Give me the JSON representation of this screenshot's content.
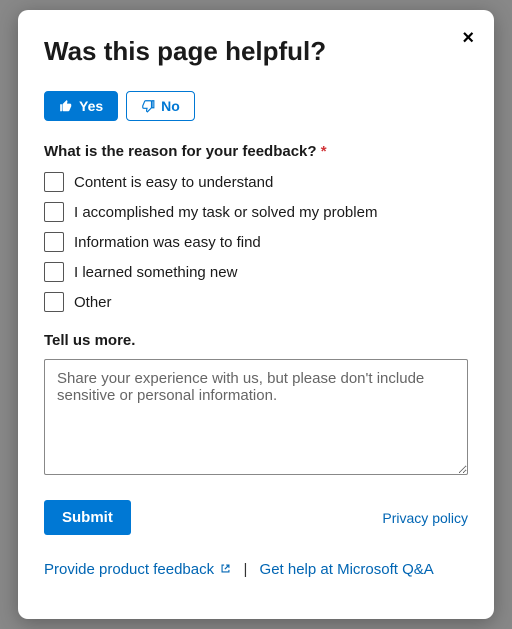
{
  "modal": {
    "title": "Was this page helpful?",
    "close_label": "×"
  },
  "vote": {
    "yes_label": "Yes",
    "no_label": "No"
  },
  "reason": {
    "question": "What is the reason for your feedback?",
    "required_mark": "*",
    "options": [
      "Content is easy to understand",
      "I accomplished my task or solved my problem",
      "Information was easy to find",
      "I learned something new",
      "Other"
    ]
  },
  "tellmore": {
    "label": "Tell us more.",
    "placeholder": "Share your experience with us, but please don't include sensitive or personal information."
  },
  "actions": {
    "submit": "Submit",
    "privacy": "Privacy policy"
  },
  "footer": {
    "product_feedback": "Provide product feedback",
    "separator": "|",
    "get_help": "Get help at Microsoft Q&A"
  }
}
